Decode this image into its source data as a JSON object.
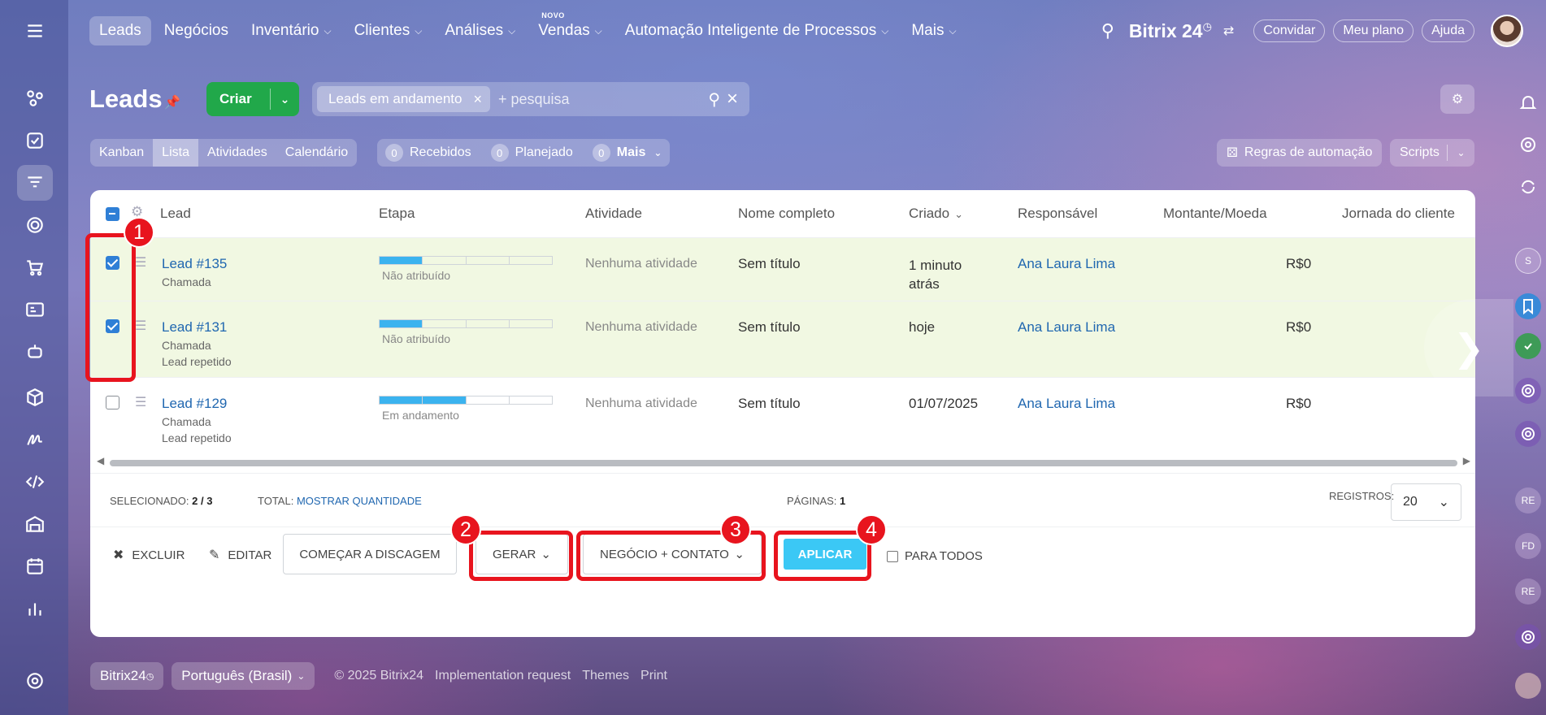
{
  "nav": {
    "items": [
      {
        "label": "Leads",
        "chevron": false,
        "active": true
      },
      {
        "label": "Negócios",
        "chevron": false
      },
      {
        "label": "Inventário",
        "chevron": true
      },
      {
        "label": "Clientes",
        "chevron": true
      },
      {
        "label": "Análises",
        "chevron": true
      },
      {
        "label": "Vendas",
        "chevron": true,
        "badge": "NOVO"
      },
      {
        "label": "Automação Inteligente de Processos",
        "chevron": true
      },
      {
        "label": "Mais",
        "chevron": true
      }
    ],
    "brand": "Bitrix 24",
    "invite": "Convidar",
    "plan": "Meu plano",
    "help": "Ajuda"
  },
  "page": {
    "title": "Leads",
    "create_label": "Criar",
    "filter_chip": "Leads em andamento",
    "search_placeholder": "+ pesquisa"
  },
  "views": [
    "Kanban",
    "Lista",
    "Atividades",
    "Calendário"
  ],
  "active_view": "Lista",
  "counters": [
    {
      "num": "0",
      "label": "Recebidos"
    },
    {
      "num": "0",
      "label": "Planejado"
    },
    {
      "num": "0",
      "label": "Mais"
    }
  ],
  "automation_rules": "Regras de automação",
  "scripts": "Scripts",
  "grid": {
    "columns": [
      "Lead",
      "Etapa",
      "Atividade",
      "Nome completo",
      "Criado",
      "Responsável",
      "Montante/Moeda",
      "Jornada do cliente"
    ],
    "rows": [
      {
        "lead": "Lead #135",
        "source": "Chamada",
        "extra": "",
        "stage_label": "Não atribuído",
        "stage_fill": 1,
        "activity": "Nenhuma atividade",
        "name": "Sem título",
        "created_1": "1 minuto",
        "created_2": "atrás",
        "owner": "Ana Laura Lima",
        "amount": "R$0",
        "selected": true
      },
      {
        "lead": "Lead #131",
        "source": "Chamada",
        "extra": "Lead repetido",
        "stage_label": "Não atribuído",
        "stage_fill": 1,
        "activity": "Nenhuma atividade",
        "name": "Sem título",
        "created_1": "hoje",
        "created_2": "",
        "owner": "Ana Laura Lima",
        "amount": "R$0",
        "selected": true
      },
      {
        "lead": "Lead #129",
        "source": "Chamada",
        "extra": "Lead repetido",
        "stage_label": "Em andamento",
        "stage_fill": 2,
        "activity": "Nenhuma atividade",
        "name": "Sem título",
        "created_1": "01/07/2025",
        "created_2": "",
        "owner": "Ana Laura Lima",
        "amount": "R$0",
        "selected": false
      }
    ]
  },
  "footer": {
    "selected_label": "SELECIONADO:",
    "selected_value": "2 / 3",
    "total_label": "TOTAL:",
    "total_link": "MOSTRAR QUANTIDADE",
    "pages_label": "PÁGINAS:",
    "pages_value": "1",
    "records_label": "REGISTROS:",
    "records_value": "20"
  },
  "actions": {
    "delete": "EXCLUIR",
    "edit": "EDITAR",
    "dial": "COMEÇAR A DISCAGEM",
    "generate": "GERAR",
    "convert": "NEGÓCIO + CONTATO",
    "apply": "APLICAR",
    "for_all": "PARA TODOS"
  },
  "annotations": [
    "1",
    "2",
    "3",
    "4"
  ],
  "bottom": {
    "brand_chip": "Bitrix24",
    "language": "Português (Brasil)",
    "copyright": "© 2025 Bitrix24",
    "impl": "Implementation request",
    "themes": "Themes",
    "print": "Print"
  },
  "right_rail": [
    "S",
    "RE",
    "FD",
    "RE"
  ],
  "colors": {
    "accent_green": "#21a84a",
    "apply_blue": "#3bc8f5",
    "annotation_red": "#e8141e",
    "link": "#2067b0"
  }
}
